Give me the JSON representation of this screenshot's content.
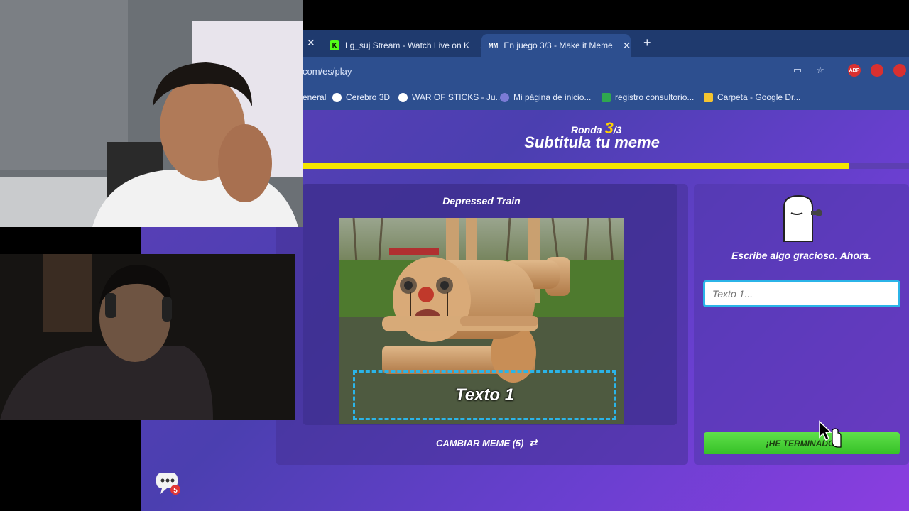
{
  "browser": {
    "tabs": [
      {
        "title": "Lg_suj Stream - Watch Live on K",
        "active": false
      },
      {
        "title": "En juego 3/3 - Make it Meme",
        "active": true
      }
    ],
    "url": "com/es/play",
    "bookmarks": [
      {
        "label": "eneral",
        "color": "#888888"
      },
      {
        "label": "Cerebro 3D",
        "color": "#ffffff"
      },
      {
        "label": "WAR OF STICKS - Ju...",
        "color": "#ffffff"
      },
      {
        "label": "Mi página de inicio...",
        "color": "#7b7bd6"
      },
      {
        "label": "registro consultorio...",
        "color": "#2fa84f"
      },
      {
        "label": "Carpeta - Google Dr...",
        "color": "#f4c430"
      }
    ],
    "extensions": [
      "ABP",
      "",
      ""
    ]
  },
  "game": {
    "round_label": "Ronda",
    "round_current": "3",
    "round_total": "/3",
    "title": "Subtitula tu meme",
    "progress": 0.9,
    "meme_name": "Depressed Train",
    "caption_preview": "Texto 1",
    "change_meme_label": "CAMBIAR MEME (5)",
    "prompt": "Escribe algo gracioso. Ahora.",
    "input_placeholder": "Texto 1...",
    "done_label": "¡HE TERMINADO!",
    "chat_unread": "5"
  }
}
